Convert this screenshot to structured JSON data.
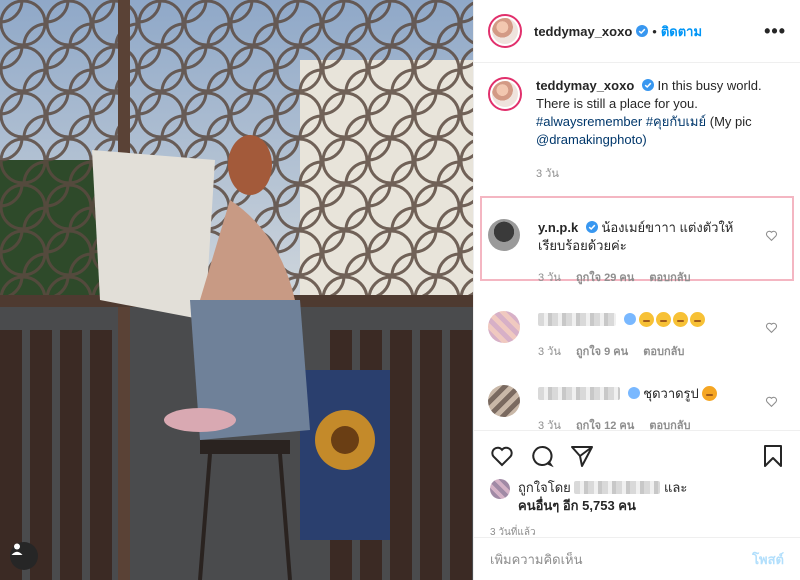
{
  "colors": {
    "accent": "#0095f6",
    "verified": "#3897f0",
    "highlight_border": "#f4b6c2",
    "muted": "#8e8e8e"
  },
  "photo": {
    "alt_content": ""
  },
  "header": {
    "username": "teddymay_xoxo",
    "separator": "•",
    "follow_label": "ติดตาม",
    "more_label": "•••"
  },
  "caption": {
    "username": "teddymay_xoxo",
    "text": "In this busy world. There is still a place for you.",
    "hashtags": "#alwaysremember #คุยกับเมย์",
    "tail": "(My pic",
    "mention": "@dramakingphoto)",
    "time": "3 วัน"
  },
  "comments": [
    {
      "username": "y.n.p.k",
      "verified": true,
      "text": "น้องเมย์ขาาา แต่งตัวให้เรียบร้อยด้วยค่ะ",
      "time": "3 วัน",
      "likes": "ถูกใจ 29 คน",
      "reply": "ตอบกลับ"
    },
    {
      "username": "",
      "verified": true,
      "text": "",
      "emoji_count": 4,
      "time": "3 วัน",
      "likes": "ถูกใจ 9 คน",
      "reply": "ตอบกลับ"
    },
    {
      "username": "",
      "verified": true,
      "text": "ชุดวาดรูป",
      "emoji_count": 1,
      "time": "3 วัน",
      "likes": "ถูกใจ 12 คน",
      "reply": "ตอบกลับ"
    }
  ],
  "actions": {
    "liked_by_prefix": "ถูกใจโดย",
    "liked_by_suffix": "และ",
    "others": "คนอื่นๆ อีก 5,753 คน",
    "ago": "3 วันที่แล้ว"
  },
  "add_comment": {
    "placeholder": "เพิ่มความคิดเห็น",
    "post_label": "โพสต์"
  }
}
